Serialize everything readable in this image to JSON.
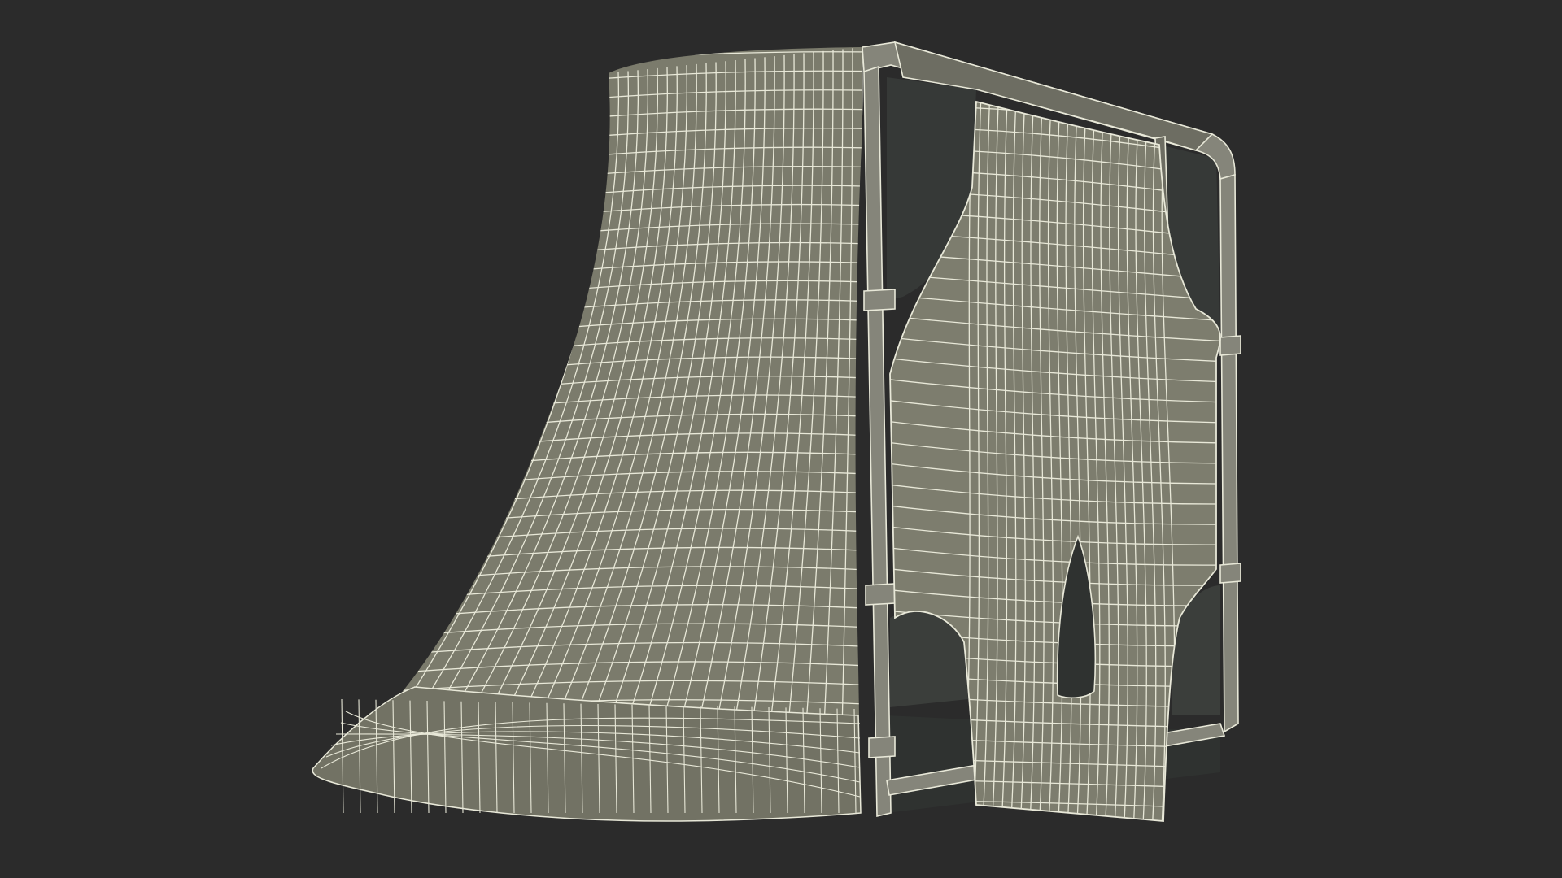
{
  "scene": {
    "subject": "wireframe-3d-model",
    "colors": {
      "background": "#2b2b2b",
      "mesh_fill": "#7b7b6c",
      "mesh_fill_shade": "#6a6a5d",
      "mesh_fill_light": "#8a8a7a",
      "wire": "#e8e8d8",
      "interior": "#3a3d3a",
      "interior_dark": "#2f3230"
    }
  }
}
